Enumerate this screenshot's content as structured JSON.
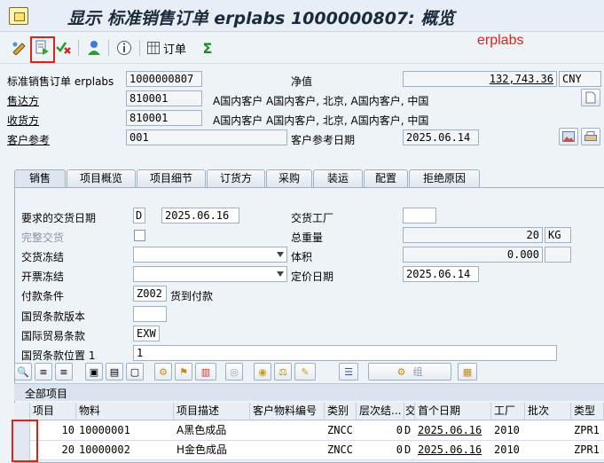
{
  "title": "显示 标准销售订单 erplabs 1000000807: 概览",
  "watermark": "erplabs",
  "toolbar": {
    "icons": [
      "display-change-icon",
      "document-flow-icon",
      "check-cancel-icon",
      "person-icon",
      "info-icon",
      "orders-icon",
      "sum-icon"
    ],
    "orders_label": "订单",
    "sum_glyph": "Σ"
  },
  "header": {
    "order_label": "标准销售订单 erplabs",
    "order_no": "1000000807",
    "net_value_label": "净值",
    "net_value": "132,743.36",
    "currency": "CNY",
    "sold_to_label": "售达方",
    "sold_to": "810001",
    "sold_to_desc": "A国内客户 A国内客户, 北京, A国内客户, 中国",
    "ship_to_label": "收货方",
    "ship_to": "810001",
    "ship_to_desc": "A国内客户 A国内客户, 北京, A国内客户, 中国",
    "cust_ref_label": "客户参考",
    "cust_ref": "001",
    "cust_ref_date_label": "客户参考日期",
    "cust_ref_date": "2025.06.14"
  },
  "tabs": [
    "销售",
    "项目概览",
    "项目细节",
    "订货方",
    "采购",
    "装运",
    "配置",
    "拒绝原因"
  ],
  "sales": {
    "req_date_label": "要求的交货日期",
    "req_date_type": "D",
    "req_date": "2025.06.16",
    "plant_label": "交货工厂",
    "plant": "",
    "complete_label": "完整交货",
    "gross_weight_label": "总重量",
    "gross_weight": "20",
    "weight_unit": "KG",
    "delivery_block_label": "交货冻结",
    "volume_label": "体积",
    "volume": "0.000",
    "billing_block_label": "开票冻结",
    "pricing_date_label": "定价日期",
    "pricing_date": "2025.06.14",
    "payment_terms_label": "付款条件",
    "payment_terms": "Z002",
    "payment_terms_desc": "货到付款",
    "incoterms_version_label": "国贸条款版本",
    "incoterms_label": "国际贸易条款",
    "incoterms": "EXW",
    "incoterms_loc_label": "国贸条款位置 1",
    "incoterms_loc": "1"
  },
  "table_toolbar": {
    "group_label": "组"
  },
  "items": {
    "title": "全部项目",
    "columns": [
      "项目",
      "物料",
      "项目描述",
      "客户物料编号",
      "类别",
      "层次结...",
      "交",
      "首个日期",
      "工厂",
      "批次",
      "类型"
    ],
    "rows": [
      {
        "item": "10",
        "material": "10000001",
        "desc": "A黑色成品",
        "cust_mat": "",
        "cat": "ZNCC",
        "level": "0",
        "d": "D",
        "date": "2025.06.16",
        "plant": "2010",
        "batch": "",
        "type": "ZPR1"
      },
      {
        "item": "20",
        "material": "10000002",
        "desc": "H金色成品",
        "cust_mat": "",
        "cat": "ZNCC",
        "level": "0",
        "d": "D",
        "date": "2025.06.16",
        "plant": "2010",
        "batch": "",
        "type": "ZPR1"
      }
    ]
  }
}
